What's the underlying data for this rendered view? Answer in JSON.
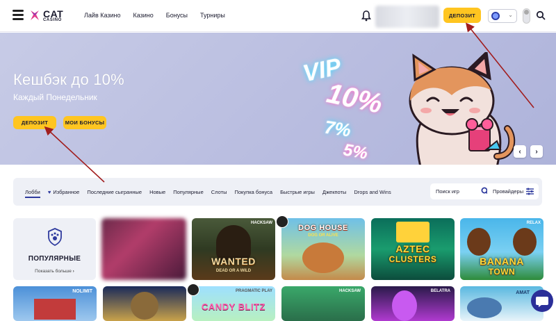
{
  "header": {
    "logo_text": "CAT",
    "logo_sub": "CASINO",
    "nav": [
      "Лайв Казино",
      "Казино",
      "Бонусы",
      "Турниры"
    ],
    "deposit_label": "ДЕПОЗИТ"
  },
  "banner": {
    "title": "Кешбэк до 10%",
    "subtitle": "Каждый Понедельник",
    "deposit_label": "ДЕПОЗИТ",
    "bonuses_label": "МОИ БОНУСЫ",
    "promo": {
      "vip": "VIP",
      "p10": "10%",
      "p7": "7%",
      "p5": "5%"
    }
  },
  "filters": {
    "categories": [
      "Лобби",
      "Избранное",
      "Последние сыгранные",
      "Новые",
      "Популярные",
      "Слоты",
      "Покупка бонуса",
      "Быстрые игры",
      "Джекпоты",
      "Drops and Wins"
    ],
    "active": "Лобби",
    "search_label": "Поиск игр",
    "providers_label": "Провайдеры"
  },
  "popular": {
    "title": "ПОПУЛЯРНЫЕ",
    "show_more": "Показать больше"
  },
  "games_row1": [
    {
      "name": "",
      "title": ""
    },
    {
      "name": "Wanted Dead or a Wild",
      "title": "WANTED",
      "sub": "DEAD OR A WILD",
      "provider": "HACKSAW"
    },
    {
      "name": "The Dog House Dog or Alive",
      "title": "DOG HOUSE",
      "sub": "DOG OR ALIVE"
    },
    {
      "name": "Aztec Clusters",
      "title": "AZTEC",
      "sub": "CLUSTERS"
    },
    {
      "name": "Banana Town",
      "title": "BANANA",
      "sub": "TOWN",
      "provider": "RELAX"
    }
  ],
  "games_row2": [
    {
      "provider": "NOLIMIT"
    },
    {
      "provider": ""
    },
    {
      "title": "CANDY BLITZ",
      "provider": "PRAGMATIC PLAY"
    },
    {
      "provider": "HACKSAW"
    },
    {
      "provider": "BELATRA"
    },
    {
      "provider": "AMAT"
    }
  ],
  "colors": {
    "accent": "#ffc520",
    "brand": "#2e3a9e",
    "banner_bg": "#bcc0e2"
  }
}
